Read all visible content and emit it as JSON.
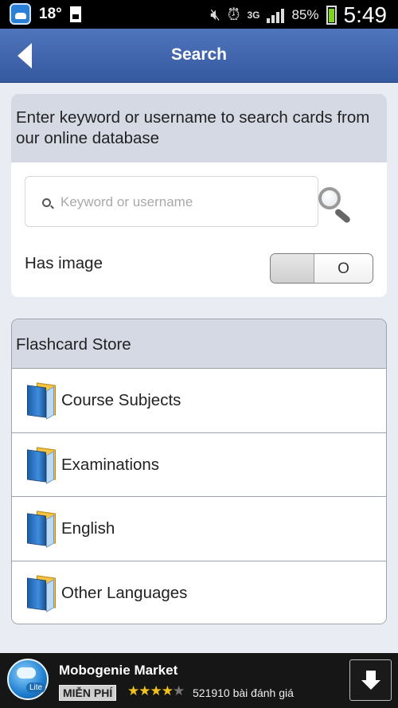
{
  "status_bar": {
    "temperature": "18°",
    "network": "3G",
    "battery": "85%",
    "time": "5:49",
    "icons": [
      "weather-app-icon",
      "sd-card-icon",
      "mute-icon",
      "alarm-icon",
      "signal-icon",
      "battery-icon"
    ]
  },
  "header": {
    "title": "Search",
    "back_icon": "back-arrow-icon",
    "bar_color": "#4466ad"
  },
  "search": {
    "description": "Enter keyword or username to search cards from our online database",
    "placeholder": "Keyword or username",
    "value": "",
    "has_image_label": "Has image",
    "toggle_text": "O",
    "toggle_on": false
  },
  "store": {
    "title": "Flashcard Store",
    "items": [
      {
        "label": "Course Subjects",
        "icon": "book-icon"
      },
      {
        "label": "Examinations",
        "icon": "book-icon"
      },
      {
        "label": "English",
        "icon": "book-icon"
      },
      {
        "label": "Other Languages",
        "icon": "book-icon"
      }
    ]
  },
  "ad": {
    "title": "Mobogenie Market",
    "badge": "MIỄN PHÍ",
    "logo_text": "Lite",
    "rating": 4,
    "rating_max": 5,
    "reviews": "521910 bài đánh giá",
    "download_icon": "download-arrow-icon"
  }
}
